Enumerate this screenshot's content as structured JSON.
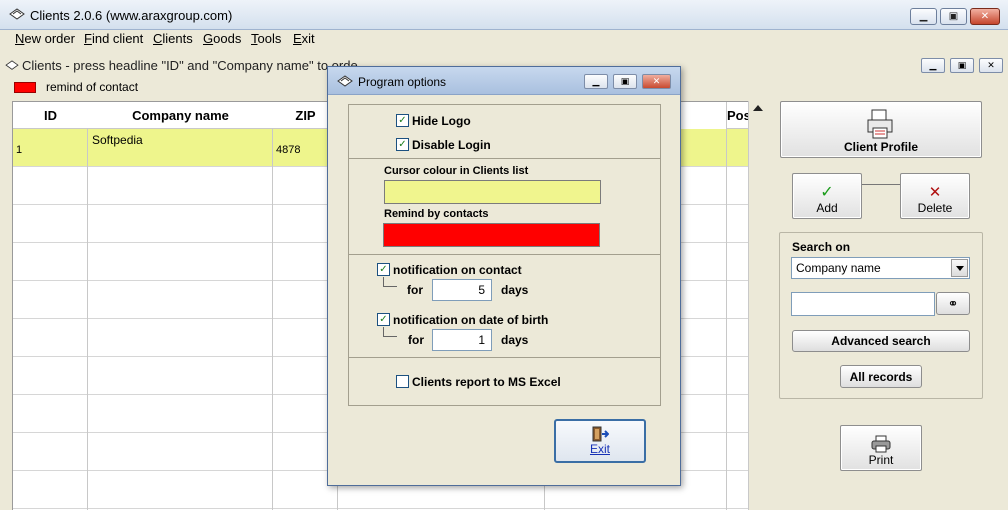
{
  "window": {
    "title": "Clients 2.0.6 (www.araxgroup.com)"
  },
  "menu": [
    {
      "first": "N",
      "rest": "ew order"
    },
    {
      "first": "F",
      "rest": "ind client"
    },
    {
      "first": "C",
      "rest": "lients"
    },
    {
      "first": "G",
      "rest": "oods"
    },
    {
      "first": "T",
      "rest": "ools"
    },
    {
      "first": "E",
      "rest": "xit"
    }
  ],
  "child_window": {
    "title": "Clients - press headline \"ID\" and \"Company name\" to orde"
  },
  "legend": {
    "text": "remind of contact",
    "color": "#ff0000"
  },
  "table": {
    "headers": {
      "id": "ID",
      "company": "Company name",
      "zip": "ZIP",
      "pos": "Pos"
    },
    "rows": [
      {
        "id": "1",
        "company": "Softpedia",
        "zip": "4878"
      }
    ],
    "selected_color": "#eef58c"
  },
  "right_panel": {
    "client_profile": "Client Profile",
    "add": "Add",
    "delete": "Delete",
    "search_on_label": "Search on",
    "search_on_value": "Company name",
    "search_input_value": "",
    "advanced_search": "Advanced search",
    "all_records": "All records",
    "print": "Print"
  },
  "dialog": {
    "title": "Program options",
    "hide_logo": {
      "label": "Hide Logo",
      "checked": true
    },
    "disable_login": {
      "label": "Disable Login",
      "checked": true
    },
    "cursor_colour_label": "Cursor colour in Clients list",
    "cursor_colour": "#f0f58e",
    "remind_label": "Remind by contacts",
    "remind_colour": "#ff0000",
    "notification_contact": {
      "label": "notification on contact",
      "checked": true,
      "for": "for",
      "value": "5",
      "unit": "days"
    },
    "notification_birth": {
      "label": "notification on date of birth",
      "checked": true,
      "for": "for",
      "value": "1",
      "unit": "days"
    },
    "excel_report": {
      "label": "Clients report to MS Excel",
      "checked": false
    },
    "exit": "Exit"
  }
}
